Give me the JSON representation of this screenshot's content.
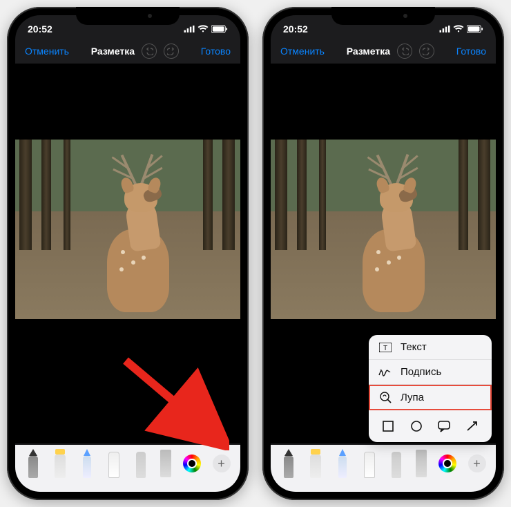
{
  "status": {
    "time": "20:52"
  },
  "nav": {
    "cancel": "Отменить",
    "title": "Разметка",
    "done": "Готово"
  },
  "popup": {
    "text": "Текст",
    "signature": "Подпись",
    "magnifier": "Лупа"
  },
  "icons": {
    "undo": "undo-icon",
    "redo": "redo-icon",
    "signal": "signal-icon",
    "wifi": "wifi-icon",
    "battery": "battery-icon",
    "pen": "pen-tool-icon",
    "marker": "marker-tool-icon",
    "pencil": "pencil-tool-icon",
    "eraser": "eraser-tool-icon",
    "lasso": "lasso-tool-icon",
    "ruler": "ruler-tool-icon",
    "color": "color-picker-icon",
    "plus": "plus-icon",
    "text": "text-icon",
    "sig": "signature-icon",
    "mag": "magnifier-icon",
    "square": "square-shape-icon",
    "circle": "circle-shape-icon",
    "bubble": "speech-bubble-shape-icon",
    "arrow": "arrow-shape-icon"
  }
}
